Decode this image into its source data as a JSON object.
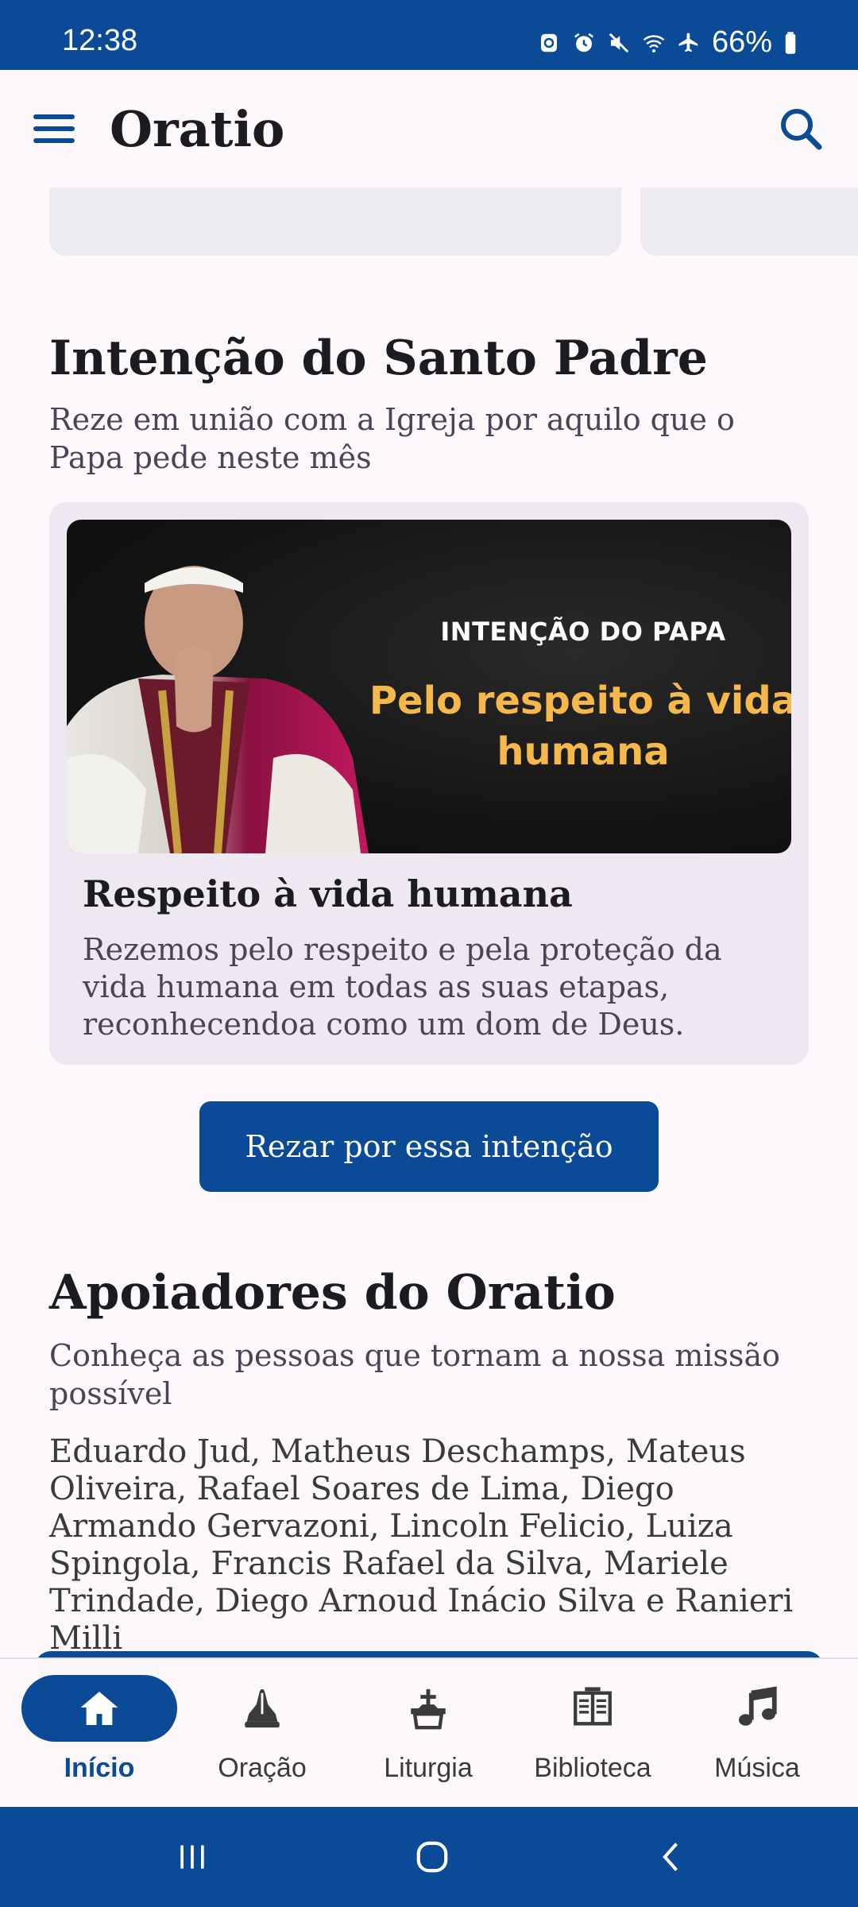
{
  "status_bar": {
    "time": "12:38",
    "battery": "66%",
    "icons": [
      "sync-icon",
      "alarm-icon",
      "mute-icon",
      "wifi-icon",
      "airplane-icon",
      "battery-icon"
    ]
  },
  "app_bar": {
    "title": "Oratio",
    "menu_icon": "menu-icon",
    "search_icon": "search-icon"
  },
  "intention_section": {
    "title": "Intenção do Santo Padre",
    "subtitle": "Reze em união com a Igreja por aquilo que o Papa pede neste mês",
    "banner": {
      "kicker": "INTENÇÃO DO PAPA",
      "headline": "Pelo respeito à vida humana"
    },
    "card_title": "Respeito à vida humana",
    "card_description": "Rezemos pelo respeito e pela proteção da vida humana em todas as suas etapas, reconhecendoa como um dom de Deus.",
    "button_label": "Rezar por essa intenção"
  },
  "supporters_section": {
    "title": "Apoiadores do Oratio",
    "subtitle": "Conheça as pessoas que tornam a nossa missão possível",
    "names": "Eduardo Jud, Matheus Deschamps, Mateus Oliveira, Rafael Soares de Lima, Diego Armando Gervazoni, Lincoln Felicio, Luiza Spingola, Francis Rafael da Silva, Mariele Trindade, Diego Arnoud Inácio Silva e Ranieri Milli"
  },
  "bottom_nav": {
    "items": [
      {
        "label": "Início",
        "icon": "home-icon",
        "active": true
      },
      {
        "label": "Oração",
        "icon": "praying-hands-icon",
        "active": false
      },
      {
        "label": "Liturgia",
        "icon": "altar-icon",
        "active": false
      },
      {
        "label": "Biblioteca",
        "icon": "book-icon",
        "active": false
      },
      {
        "label": "Música",
        "icon": "music-note-icon",
        "active": false
      }
    ]
  },
  "colors": {
    "primary": "#0a4a96",
    "banner_accent": "#f6b84b",
    "card_background": "#ede8f1",
    "page_background": "#fdf8fc"
  }
}
